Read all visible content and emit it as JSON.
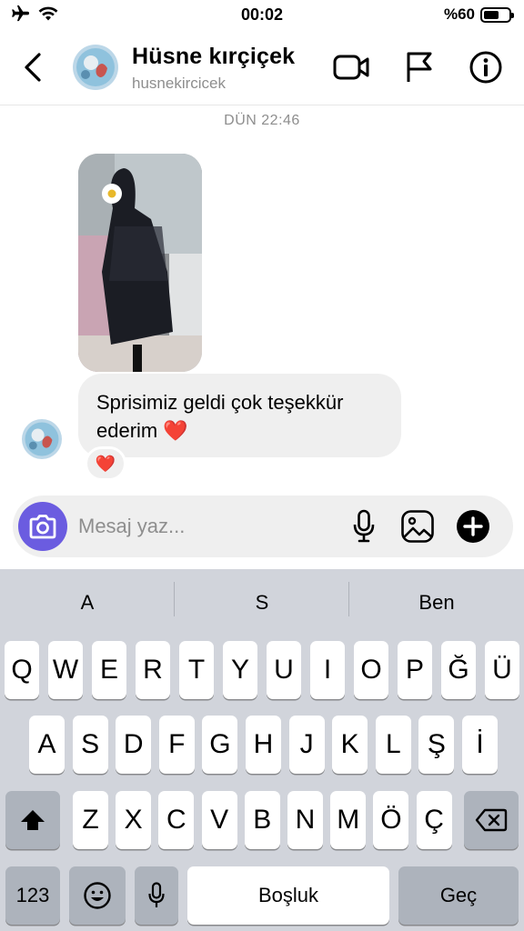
{
  "status_bar": {
    "time": "00:02",
    "battery_label": "%60",
    "battery_level": 0.6,
    "icons": [
      "airplane-icon",
      "wifi-icon",
      "battery-icon"
    ]
  },
  "header": {
    "name": "Hüsne kırçiçek",
    "username": "husnekircicek",
    "icons": [
      "back-icon",
      "video-call-icon",
      "flag-icon",
      "info-icon"
    ]
  },
  "chat": {
    "date_label": "DÜN 22:46",
    "messages": [
      {
        "type": "photo",
        "description_icon": "photo-icon"
      },
      {
        "type": "text",
        "text": "Sprisimiz geldi çok teşekkür ederim",
        "emoji": "❤️"
      }
    ],
    "reaction": "❤️"
  },
  "composer": {
    "placeholder": "Mesaj yaz...",
    "icons": [
      "camera-icon",
      "microphone-icon",
      "gallery-icon",
      "add-icon"
    ]
  },
  "keyboard": {
    "suggestions": [
      "A",
      "S",
      "Ben"
    ],
    "rows": [
      [
        "Q",
        "W",
        "E",
        "R",
        "T",
        "Y",
        "U",
        "I",
        "O",
        "P",
        "Ğ",
        "Ü"
      ],
      [
        "A",
        "S",
        "D",
        "F",
        "G",
        "H",
        "J",
        "K",
        "L",
        "Ş",
        "İ"
      ],
      [
        "Z",
        "X",
        "C",
        "V",
        "B",
        "N",
        "M",
        "Ö",
        "Ç"
      ]
    ],
    "numbers_label": "123",
    "space_label": "Boşluk",
    "return_label": "Geç",
    "colors": {
      "background": "#d1d4db",
      "key": "#ffffff",
      "dark_key": "#adb3bc"
    }
  },
  "colors": {
    "accent": "#6b5ce0",
    "bubble": "#efefef",
    "secondary_text": "#8e8e8e",
    "heart": "#d7142b"
  }
}
